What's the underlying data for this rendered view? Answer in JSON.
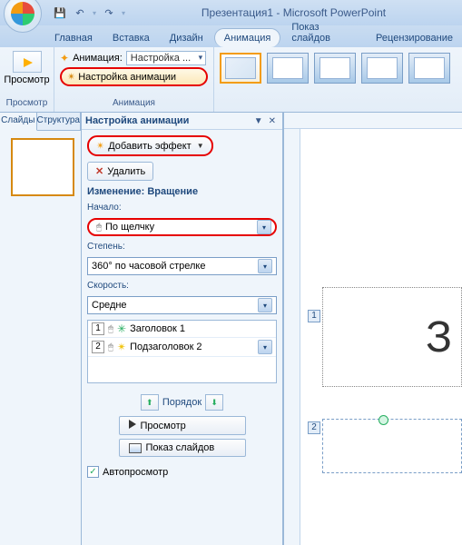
{
  "window": {
    "title": "Презентация1 - Microsoft PowerPoint"
  },
  "tabs": {
    "home": "Главная",
    "insert": "Вставка",
    "design": "Дизайн",
    "animation": "Анимация",
    "slideshow": "Показ слайдов",
    "review": "Рецензирование"
  },
  "ribbon": {
    "preview_label": "Просмотр",
    "preview_group": "Просмотр",
    "anim_label": "Анимация:",
    "anim_value": "Настройка ...",
    "anim_settings": "Настройка анимации",
    "anim_group": "Анимация"
  },
  "left_panel": {
    "tab_slides": "Слайды",
    "tab_structure": "Структура"
  },
  "pane": {
    "title": "Настройка анимации",
    "add_effect": "Добавить эффект",
    "delete": "Удалить",
    "change_label": "Изменение: Вращение",
    "start_label": "Начало:",
    "start_value": "По щелчку",
    "degree_label": "Степень:",
    "degree_value": "360° по часовой стрелке",
    "speed_label": "Скорость:",
    "speed_value": "Средне",
    "effects": [
      {
        "num": "1",
        "name": "Заголовок 1"
      },
      {
        "num": "2",
        "name": "Подзаголовок 2"
      }
    ],
    "order_label": "Порядок",
    "play": "Просмотр",
    "slideshow": "Показ слайдов",
    "autopreview": "Автопросмотр"
  },
  "canvas": {
    "title_text": "З",
    "tag1": "1",
    "tag2": "2"
  }
}
